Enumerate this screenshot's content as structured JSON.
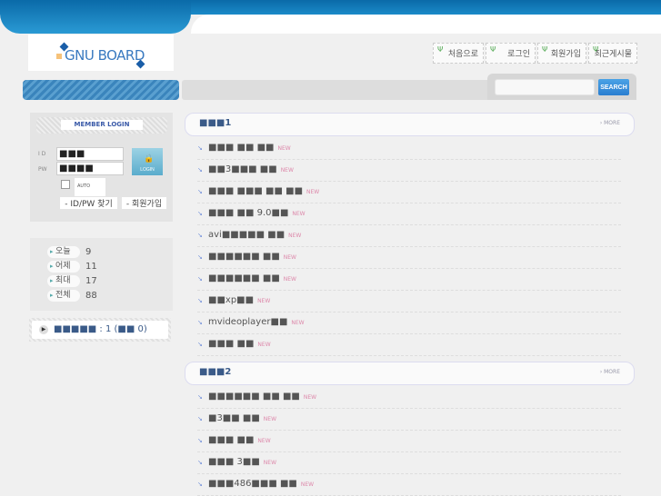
{
  "logo": "GNU BOARD",
  "nav": [
    "처음으로",
    "로그인",
    "회원가입",
    "최근게시물"
  ],
  "search": {
    "placeholder": "",
    "button": "SEARCH"
  },
  "login": {
    "title": "MEMBER LOGIN",
    "id_label": "I D",
    "pw_label": "PW",
    "id_value": "■■■",
    "pw_value": "■■■■",
    "button": "LOGIN",
    "auto": "AUTO",
    "find": "- ID/PW 찾기",
    "join": "- 회원가입"
  },
  "stats": [
    {
      "label": "오늘",
      "value": "9"
    },
    {
      "label": "어제",
      "value": "11"
    },
    {
      "label": "최대",
      "value": "17"
    },
    {
      "label": "전체",
      "value": "88"
    }
  ],
  "visitor": "■■■■■ : 1 (■■ 0)",
  "sections": [
    {
      "title": "■■■1",
      "more": "› MORE",
      "rows": [
        "■■■ ■■ ■■",
        "■■3■■■ ■■",
        "■■■ ■■■ ■■ ■■",
        "■■■ ■■ 9.0■■",
        "avi■■■■■ ■■",
        "■■■■■■ ■■",
        "■■■■■■ ■■",
        "■■xp■■",
        "mvideoplayer■■",
        "■■■ ■■"
      ]
    },
    {
      "title": "■■■2",
      "more": "› MORE",
      "rows": [
        "■■■■■■ ■■ ■■",
        "■3■■ ■■",
        "■■■ ■■",
        "■■■ 3■■",
        "■■■486■■■ ■■"
      ]
    }
  ],
  "new_badge": "NEW"
}
